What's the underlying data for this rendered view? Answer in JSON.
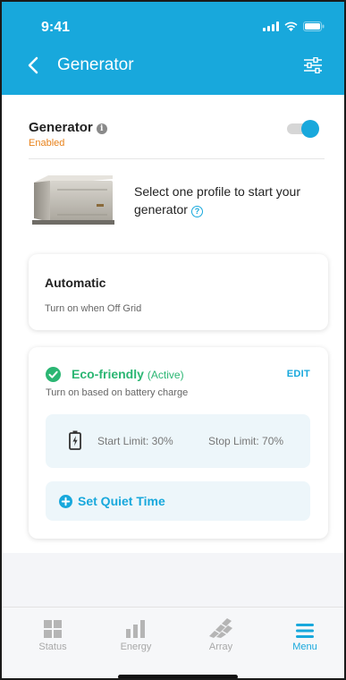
{
  "status_bar": {
    "time": "9:41"
  },
  "header": {
    "title": "Generator",
    "back_icon": "chevron-left-icon",
    "settings_icon": "sliders-icon"
  },
  "generator": {
    "label": "Generator",
    "status": "Enabled",
    "toggle_on": true,
    "prompt": "Select one profile to start your generator"
  },
  "profiles": {
    "automatic": {
      "title": "Automatic",
      "subtitle": "Turn on when Off Grid"
    },
    "eco": {
      "title": "Eco-friendly",
      "active_tag": "(Active)",
      "edit_label": "EDIT",
      "subtitle": "Turn on based on battery charge",
      "start_limit": "Start Limit: 30%",
      "stop_limit": "Stop Limit: 70%",
      "quiet_time_label": "Set Quiet Time"
    }
  },
  "bottom_nav": [
    {
      "label": "Status",
      "icon": "grid-icon",
      "active": false
    },
    {
      "label": "Energy",
      "icon": "bar-chart-icon",
      "active": false
    },
    {
      "label": "Array",
      "icon": "solar-array-icon",
      "active": false
    },
    {
      "label": "Menu",
      "icon": "menu-icon",
      "active": true
    }
  ],
  "colors": {
    "brand": "#18a8dc",
    "enabled": "#e8821b",
    "active_green": "#2bb673"
  }
}
